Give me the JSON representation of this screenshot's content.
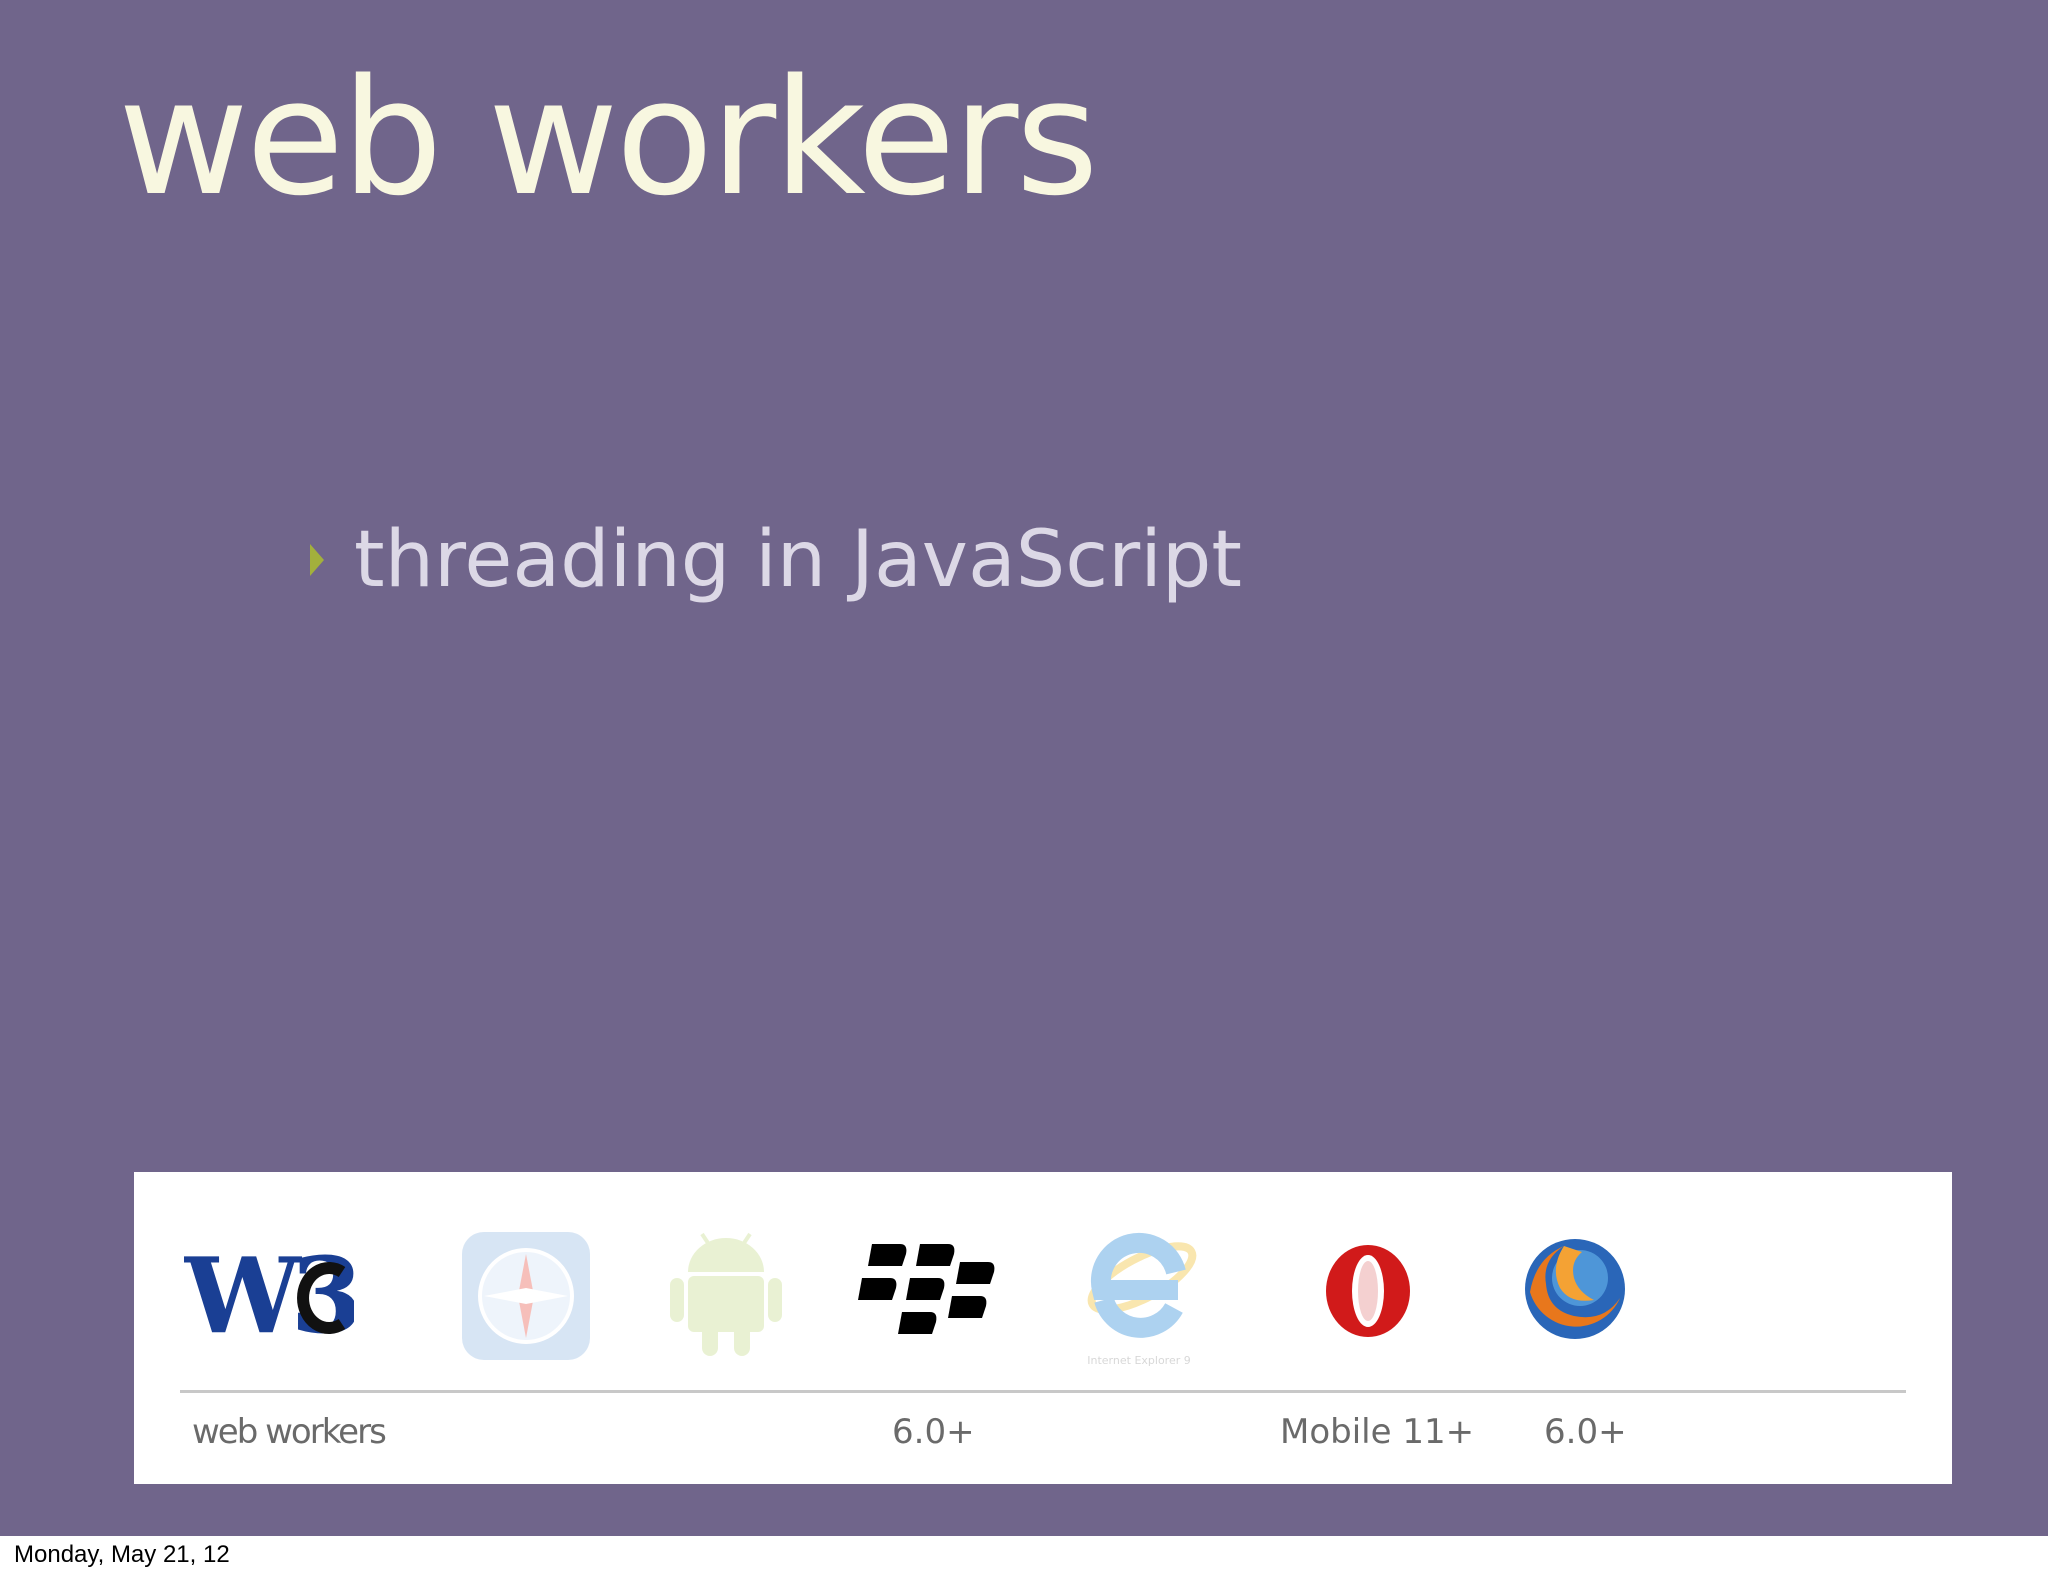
{
  "slide": {
    "title": "web workers",
    "bullets": [
      "threading in JavaScript"
    ],
    "background_color": "#70658b",
    "title_color": "#f8f7e0",
    "bullet_marker_color": "#a3b03c"
  },
  "support_table": {
    "logos": [
      {
        "icon": "w3c-logo",
        "text": "W3C",
        "label": ""
      },
      {
        "icon": "safari-icon",
        "label": ""
      },
      {
        "icon": "android-icon",
        "label": ""
      },
      {
        "icon": "blackberry-icon",
        "label": "6.0+"
      },
      {
        "icon": "internet-explorer-icon",
        "text": "Internet Explorer 9",
        "label": ""
      },
      {
        "icon": "opera-icon",
        "label": "Mobile 11+"
      },
      {
        "icon": "firefox-icon",
        "label": "6.0+"
      }
    ],
    "feature_label": "web workers"
  },
  "footer": {
    "date": "Monday, May 21, 12"
  }
}
